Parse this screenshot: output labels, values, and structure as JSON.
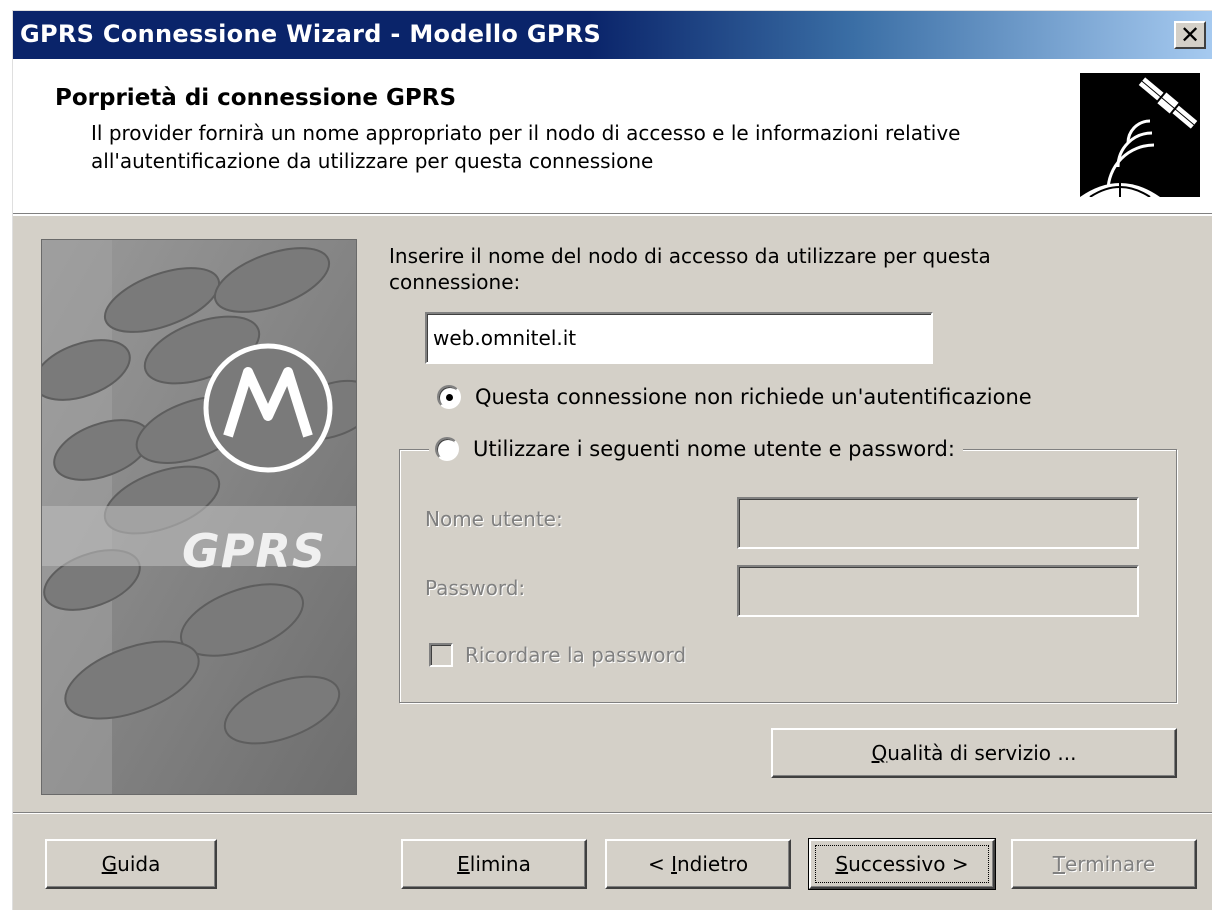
{
  "window": {
    "title": "GPRS Connessione Wizard - Modello GPRS",
    "close_glyph": "✕"
  },
  "header": {
    "title": "Porprietà di connessione GPRS",
    "description": "Il provider fornirà un nome appropriato per il nodo di accesso e le informazioni relative all'autentificazione da utilizzare per questa connessione",
    "icon": "satellite-icon"
  },
  "side_image": {
    "brand_label": "GPRS",
    "logo": "motorola-logo"
  },
  "form": {
    "prompt": "Inserire il nome del nodo di accesso da utilizzare per questa connessione:",
    "apn_value": "web.omnitel.it",
    "radio_no_auth": {
      "label": "Questa connessione non richiede un'autentificazione",
      "checked": true
    },
    "radio_use_credentials": {
      "label": "Utilizzare i seguenti nome utente e password:",
      "checked": false
    },
    "username_label": "Nome utente:",
    "username_value": "",
    "password_label": "Password:",
    "password_value": "",
    "remember_label": "Ricordare la password",
    "remember_checked": false,
    "qos_button": {
      "mnemonic": "Q",
      "rest": "ualità di servizio ..."
    }
  },
  "footer": {
    "help": {
      "mnemonic": "G",
      "rest": "uida"
    },
    "delete": {
      "mnemonic": "E",
      "rest": "limina"
    },
    "back": {
      "prefix": "< ",
      "mnemonic": "I",
      "rest": "ndietro"
    },
    "next": {
      "mnemonic": "S",
      "rest": "uccessivo >"
    },
    "finish": {
      "mnemonic": "T",
      "rest": "erminare"
    }
  },
  "colors": {
    "titlebar_start": "#0a246a",
    "titlebar_end": "#a6caf0",
    "dialog_face": "#d4d0c8",
    "disabled_text": "#808080"
  }
}
